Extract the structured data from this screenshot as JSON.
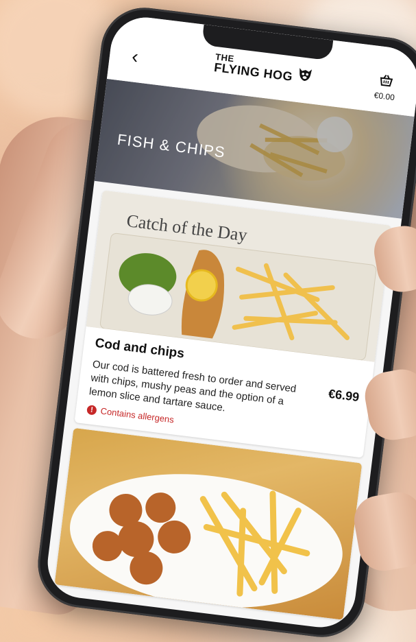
{
  "app": {
    "brand_the": "THE",
    "brand_name": "FLYING HOG"
  },
  "header": {
    "back_icon": "chevron-left-icon",
    "cart_icon": "basket-icon",
    "cart_total": "€0.00"
  },
  "category": {
    "title": "FISH & CHIPS"
  },
  "items": [
    {
      "name": "Cod and chips",
      "price": "€6.99",
      "description": "Our cod is battered fresh to order and served with chips, mushy peas and the option of a lemon slice and tartare sauce.",
      "allergen_label": "Contains allergens",
      "allergen_icon": "warning-icon",
      "image_caption": "Catch of the Day"
    },
    {
      "name": "",
      "image_alt": "chicken nuggets and chips"
    }
  ],
  "colors": {
    "allergen": "#c62828",
    "text": "#111111",
    "background": "#f6f6f6"
  }
}
